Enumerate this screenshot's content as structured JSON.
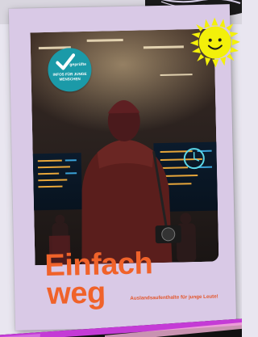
{
  "brochure": {
    "title_line1": "Einfach",
    "title_line2": "weg",
    "subtitle": "Auslandsaufenthalte für junge Leute!",
    "badge": {
      "small_label": "geprüfte",
      "text": "INFOS FÜR JUNGE MENSCHEN"
    }
  },
  "colors": {
    "brochure_background": "#d9c9e6",
    "title": "#f0622a",
    "badge": "#1b9aa8",
    "sun": "#f3f00a"
  },
  "icons": {
    "badge": "checkmark-icon",
    "sun": "smiley-sun-icon"
  }
}
